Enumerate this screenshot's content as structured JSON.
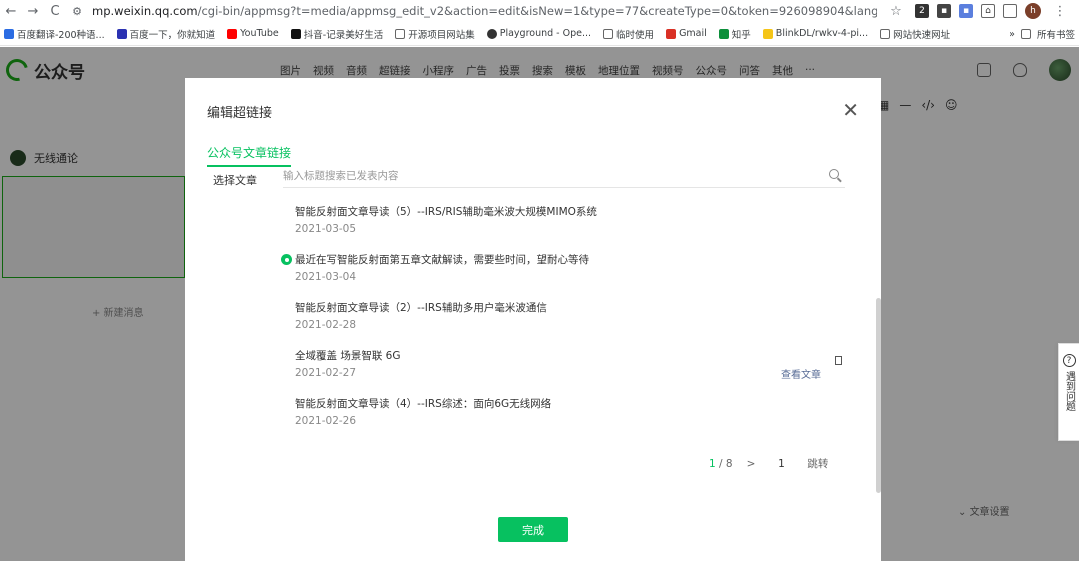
{
  "browser": {
    "url_host": "mp.weixin.qq.com",
    "url_rest": "/cgi-bin/appmsg?t=media/appmsg_edit_v2&action=edit&isNew=1&type=77&createType=0&token=926098904&lang=zh_CN&timesta...",
    "bookmarks": [
      {
        "label": "百度翻译-200种语...",
        "color": "#2b6ce3"
      },
      {
        "label": "百度一下，你就知道",
        "color": "#2b32b2"
      },
      {
        "label": "YouTube",
        "color": "#ff0000"
      },
      {
        "label": "抖音-记录美好生活",
        "color": "#111111"
      },
      {
        "label": "开源项目网站集",
        "color": "#666666"
      },
      {
        "label": "Playground - Ope...",
        "color": "#333333"
      },
      {
        "label": "临时使用",
        "color": "#666666"
      },
      {
        "label": "Gmail",
        "color": "#d93025"
      },
      {
        "label": "知乎",
        "color": "#0c8f3a"
      },
      {
        "label": "BlinkDL/rwkv-4-pi...",
        "color": "#f5c518"
      },
      {
        "label": "网站快速网址",
        "color": "#666666"
      }
    ],
    "bookmarks_more": "»",
    "other_bookmarks": "所有书签"
  },
  "header": {
    "logo_text": "公众号",
    "toolbar": [
      "图片",
      "视频",
      "音频",
      "超链接",
      "小程序",
      "广告",
      "投票",
      "搜索",
      "模板",
      "地理位置",
      "视频号",
      "公众号",
      "问答",
      "其他",
      "···"
    ]
  },
  "editor": {
    "account_name": "无线通论",
    "new_message": "+ 新建消息",
    "article_settings": "文章设置",
    "help_label": "遇到问题"
  },
  "dialog": {
    "title": "编辑超链接",
    "tab": "公众号文章链接",
    "select_label": "选择文章",
    "search_placeholder": "输入标题搜索已发表内容",
    "view_article": "查看文章",
    "articles": [
      {
        "title": "智能反射面文章导读（5）--IRS/RIS辅助毫米波大规模MIMO系统",
        "date": "2021-03-05",
        "selected": false
      },
      {
        "title": "最近在写智能反射面第五章文献解读，需要些时间，望耐心等待",
        "date": "2021-03-04",
        "selected": true
      },
      {
        "title": "智能反射面文章导读（2）--IRS辅助多用户毫米波通信",
        "date": "2021-02-28",
        "selected": false
      },
      {
        "title": "全域覆盖 场景智联 6G",
        "date": "2021-02-27",
        "selected": false
      },
      {
        "title": "智能反射面文章导读（4）--IRS综述：面向6G无线网络",
        "date": "2021-02-26",
        "selected": false
      }
    ],
    "pagination": {
      "current": "1",
      "total": "/ 8",
      "next": ">",
      "jump_value": "1",
      "jump_label": "跳转"
    },
    "done_label": "完成"
  }
}
